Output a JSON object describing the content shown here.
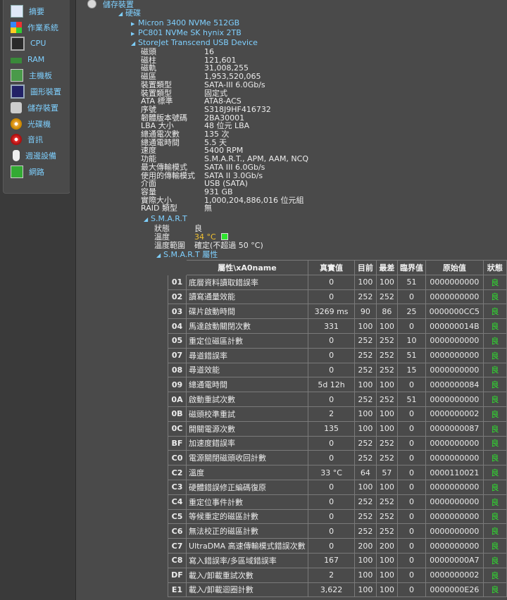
{
  "sidebar": {
    "items": [
      {
        "label": "摘要",
        "icon": "summary-icon"
      },
      {
        "label": "作業系統",
        "icon": "windows-logo-icon"
      },
      {
        "label": "CPU",
        "icon": "cpu-icon"
      },
      {
        "label": "RAM",
        "icon": "ram-icon"
      },
      {
        "label": "主機板",
        "icon": "motherboard-icon"
      },
      {
        "label": "圖形裝置",
        "icon": "monitor-icon"
      },
      {
        "label": "儲存裝置",
        "icon": "hard-drive-icon"
      },
      {
        "label": "光碟機",
        "icon": "optical-disc-icon"
      },
      {
        "label": "音訊",
        "icon": "speaker-icon"
      },
      {
        "label": "週邊設備",
        "icon": "mouse-icon"
      },
      {
        "label": "網路",
        "icon": "network-icon"
      }
    ]
  },
  "tree": {
    "root_label": "儲存裝置",
    "hdd_label": "硬碟",
    "drives": [
      "Micron 3400 NVMe 512GB",
      "PC801 NVMe SK hynix 2TB",
      "StoreJet Transcend USB Device"
    ]
  },
  "details": [
    {
      "k": "磁頭",
      "v": "16"
    },
    {
      "k": "磁柱",
      "v": "121,601"
    },
    {
      "k": "磁軌",
      "v": "31,008,255"
    },
    {
      "k": "磁區",
      "v": "1,953,520,065"
    },
    {
      "k": "裝置類型",
      "v": "SATA-III 6.0Gb/s"
    },
    {
      "k": "裝置類型",
      "v": "固定式"
    },
    {
      "k": "ATA 標準",
      "v": "ATA8-ACS"
    },
    {
      "k": "序號",
      "v": "S318J9HF416732"
    },
    {
      "k": "韌體版本號碼",
      "v": "2BA30001"
    },
    {
      "k": "LBA 大小",
      "v": "48 位元 LBA"
    },
    {
      "k": "總通電次數",
      "v": "135 次"
    },
    {
      "k": "總通電時間",
      "v": "5.5 天"
    },
    {
      "k": "速度",
      "v": "5400 RPM"
    },
    {
      "k": "功能",
      "v": "S.M.A.R.T., APM, AAM, NCQ"
    },
    {
      "k": "最大傳輸模式",
      "v": "SATA III 6.0Gb/s"
    },
    {
      "k": "使用的傳輸模式",
      "v": "SATA II 3.0Gb/s"
    },
    {
      "k": "介面",
      "v": "USB (SATA)"
    },
    {
      "k": "容量",
      "v": "931 GB"
    },
    {
      "k": "實際大小",
      "v": "1,000,204,886,016 位元組"
    },
    {
      "k": "RAID 類型",
      "v": "無"
    }
  ],
  "smart": {
    "label": "S.M.A.R.T",
    "status_key": "狀態",
    "status_val": "良",
    "temp_key": "溫度",
    "temp_val": "34 °C",
    "range_key": "溫度範圍",
    "range_val": "確定(不超過 50 °C)",
    "attr_label": "S.M.A.R.T 屬性",
    "colors": {
      "temp": "#f2c230",
      "ok": "#2ee52e"
    }
  },
  "table": {
    "headers": [
      "屬性\\xA0name",
      "真實值",
      "目前",
      "最差",
      "臨界值",
      "原始值",
      "狀態"
    ],
    "rows": [
      [
        "01",
        "底層資料讀取錯誤率",
        "0",
        "100",
        "100",
        "51",
        "0000000000",
        "良"
      ],
      [
        "02",
        "讀寫通量效能",
        "0",
        "252",
        "252",
        "0",
        "0000000000",
        "良"
      ],
      [
        "03",
        "碟片啟動時間",
        "3269 ms",
        "90",
        "86",
        "25",
        "0000000CC5",
        "良"
      ],
      [
        "04",
        "馬達啟動關閉次數",
        "331",
        "100",
        "100",
        "0",
        "000000014B",
        "良"
      ],
      [
        "05",
        "重定位磁區計數",
        "0",
        "252",
        "252",
        "10",
        "0000000000",
        "良"
      ],
      [
        "07",
        "尋道錯誤率",
        "0",
        "252",
        "252",
        "51",
        "0000000000",
        "良"
      ],
      [
        "08",
        "尋道效能",
        "0",
        "252",
        "252",
        "15",
        "0000000000",
        "良"
      ],
      [
        "09",
        "總通電時間",
        "5d 12h",
        "100",
        "100",
        "0",
        "0000000084",
        "良"
      ],
      [
        "0A",
        "啟動重試次數",
        "0",
        "252",
        "252",
        "51",
        "0000000000",
        "良"
      ],
      [
        "0B",
        "磁頭校準重試",
        "2",
        "100",
        "100",
        "0",
        "0000000002",
        "良"
      ],
      [
        "0C",
        "開關電源次數",
        "135",
        "100",
        "100",
        "0",
        "0000000087",
        "良"
      ],
      [
        "BF",
        "加速度錯誤率",
        "0",
        "252",
        "252",
        "0",
        "0000000000",
        "良"
      ],
      [
        "C0",
        "電源關閉磁頭收回計數",
        "0",
        "252",
        "252",
        "0",
        "0000000000",
        "良"
      ],
      [
        "C2",
        "溫度",
        "33 °C",
        "64",
        "57",
        "0",
        "0000110021",
        "良"
      ],
      [
        "C3",
        "硬體錯誤修正編碼復原",
        "0",
        "100",
        "100",
        "0",
        "0000000000",
        "良"
      ],
      [
        "C4",
        "重定位事件計數",
        "0",
        "252",
        "252",
        "0",
        "0000000000",
        "良"
      ],
      [
        "C5",
        "等候重定的磁區計數",
        "0",
        "252",
        "252",
        "0",
        "0000000000",
        "良"
      ],
      [
        "C6",
        "無法校正的磁區計數",
        "0",
        "252",
        "252",
        "0",
        "0000000000",
        "良"
      ],
      [
        "C7",
        "UltraDMA 高速傳輸模式錯誤次數",
        "0",
        "200",
        "200",
        "0",
        "0000000000",
        "良"
      ],
      [
        "C8",
        "寫入錯誤率/多區域錯誤率",
        "167",
        "100",
        "100",
        "0",
        "00000000A7",
        "良"
      ],
      [
        "DF",
        "載入/卸載重試次數",
        "2",
        "100",
        "100",
        "0",
        "0000000002",
        "良"
      ],
      [
        "E1",
        "載入/卸載迴圈計數",
        "3,622",
        "100",
        "100",
        "0",
        "0000000E26",
        "良"
      ]
    ]
  }
}
